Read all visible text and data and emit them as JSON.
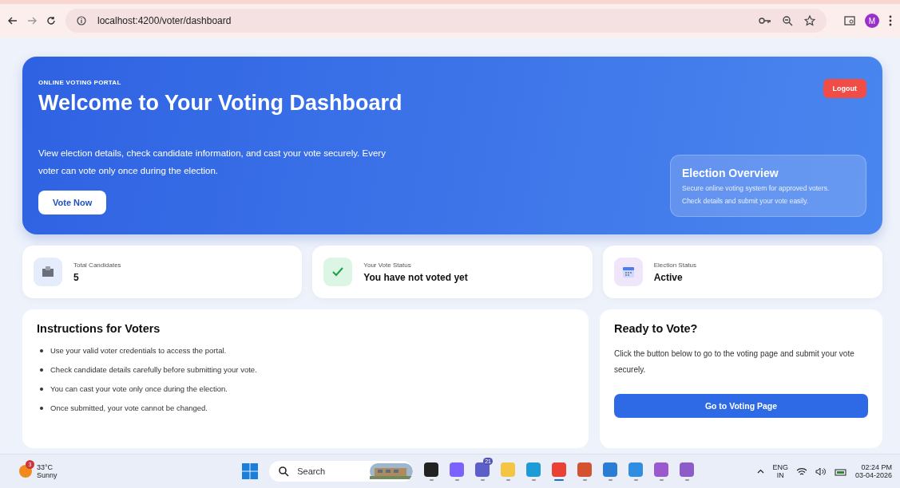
{
  "browser": {
    "url": "localhost:4200/voter/dashboard",
    "profile": "M"
  },
  "hero": {
    "eyebrow": "ONLINE VOTING PORTAL",
    "title": "Welcome to Your Voting Dashboard",
    "description": "View election details, check candidate information, and cast your vote securely. Every voter can vote only once during the election.",
    "primary_button": "Vote Now",
    "logout_button": "Logout",
    "overview": {
      "title": "Election Overview",
      "lines": [
        "Secure online voting system for approved voters.",
        "Check details and submit your vote easily."
      ]
    }
  },
  "stats": [
    {
      "kind": "candidates",
      "label": "Total Candidates",
      "value": "5"
    },
    {
      "kind": "vote",
      "label": "Your Vote Status",
      "value": "You have not voted yet"
    },
    {
      "kind": "election",
      "label": "Election Status",
      "value": "Active"
    }
  ],
  "instructions": {
    "title": "Instructions for Voters",
    "items": [
      "Use your valid voter credentials to access the portal.",
      "Check candidate details carefully before submitting your vote.",
      "You can cast your vote only once during the election.",
      "Once submitted, your vote cannot be changed."
    ]
  },
  "ready": {
    "title": "Ready to Vote?",
    "text": "Click the button below to go to the voting page and submit your vote securely.",
    "button": "Go to Voting Page"
  },
  "taskbar": {
    "weather_badge": "3",
    "temperature": "33°C",
    "condition": "Sunny",
    "search_placeholder": "Search",
    "apps": [
      {
        "kind": "task-view",
        "selected": false
      },
      {
        "kind": "copilot",
        "selected": false
      },
      {
        "kind": "teams",
        "badge": "21",
        "selected": false
      },
      {
        "kind": "folder",
        "selected": false
      },
      {
        "kind": "edge",
        "selected": false
      },
      {
        "kind": "chrome",
        "selected": true
      },
      {
        "kind": "powerpoint",
        "selected": false
      },
      {
        "kind": "word",
        "selected": false
      },
      {
        "kind": "vscode",
        "selected": false
      },
      {
        "kind": "vs-installer",
        "selected": false
      },
      {
        "kind": "visual-studio",
        "selected": false
      }
    ],
    "language": "ENG",
    "region": "IN",
    "time": "02:24 PM",
    "date": "03-04-2026"
  }
}
